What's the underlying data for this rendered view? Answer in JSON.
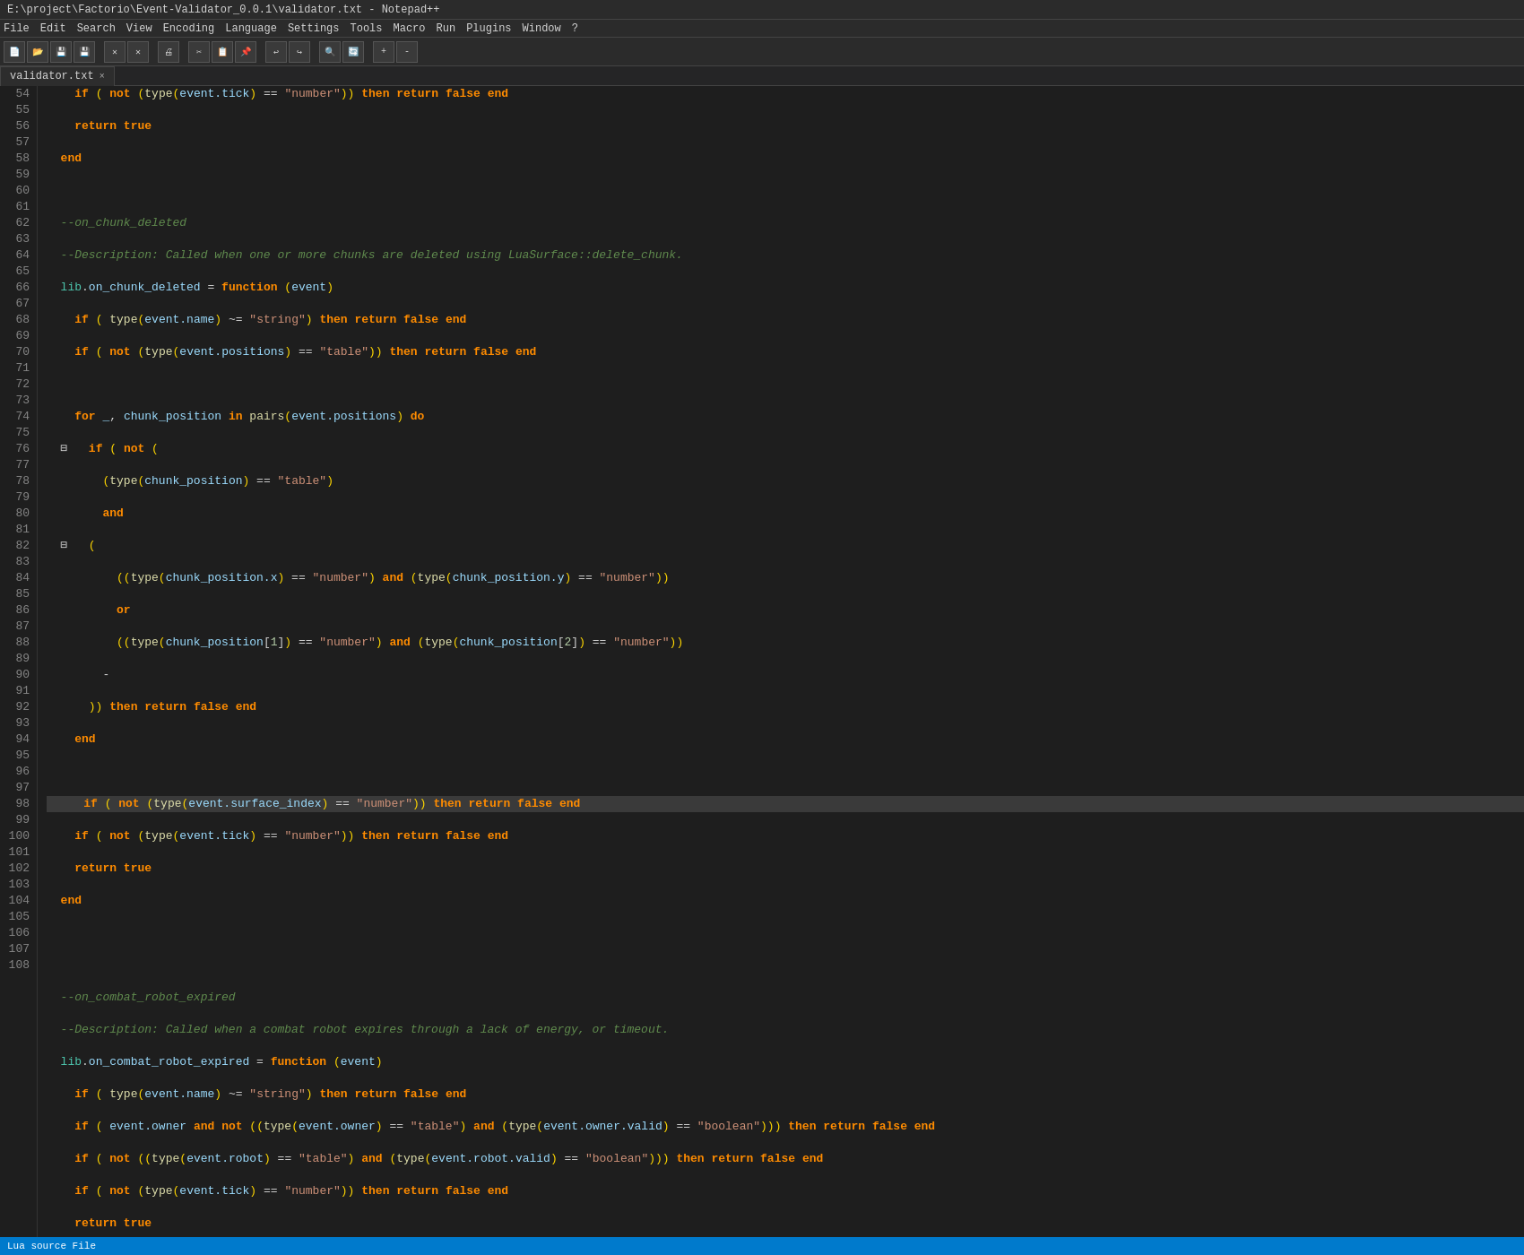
{
  "titleBar": {
    "text": "E:\\project\\Factorio\\Event-Validator_0.0.1\\validator.txt - Notepad++"
  },
  "menuBar": {
    "items": [
      "File",
      "Edit",
      "Search",
      "View",
      "Encoding",
      "Language",
      "Settings",
      "Tools",
      "Macro",
      "Run",
      "Plugins",
      "Window",
      "?"
    ]
  },
  "tabBar": {
    "tabs": [
      {
        "label": "validator.txt",
        "active": true
      }
    ]
  },
  "statusBar": {
    "text": "Lua source File"
  },
  "encoding": {
    "label": "Encoding"
  }
}
